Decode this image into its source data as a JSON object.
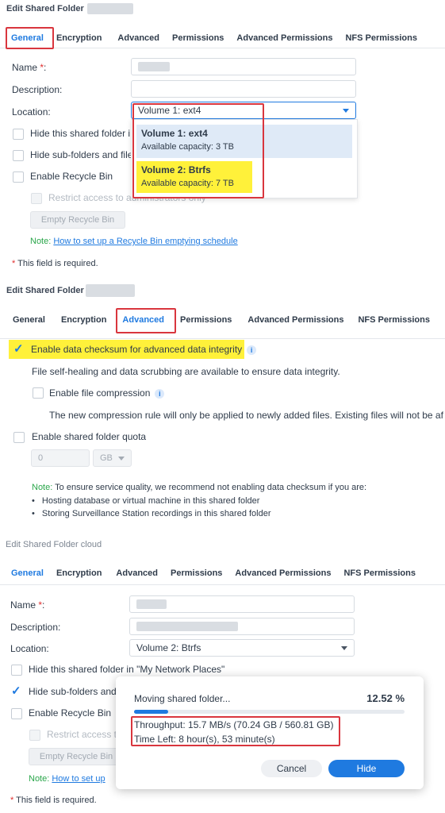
{
  "panel1": {
    "title": "Edit Shared Folder",
    "tabs": [
      "General",
      "Encryption",
      "Advanced",
      "Permissions",
      "Advanced Permissions",
      "NFS Permissions"
    ],
    "name_label": "Name",
    "description_label": "Description:",
    "location_label": "Location:",
    "location_value": "Volume 1:  ext4",
    "hide_folder_label": "Hide this shared folder i",
    "hide_subfolders_label": "Hide sub-folders and file",
    "recycle_label": "Enable Recycle Bin",
    "restrict_label": "Restrict access to administrators only",
    "empty_recycle_btn": "Empty Recycle Bin",
    "note_key": "Note:",
    "note_link": "How to set up a Recycle Bin emptying schedule",
    "required_text": "This field is required.",
    "dropdown": [
      {
        "title": "Volume 1: ext4",
        "capacity": "Available capacity: 3 TB"
      },
      {
        "title": "Volume 2: Btrfs",
        "capacity": "Available capacity: 7 TB"
      }
    ]
  },
  "panel2": {
    "title": "Edit Shared Folder",
    "tabs": [
      "General",
      "Encryption",
      "Advanced",
      "Permissions",
      "Advanced Permissions",
      "NFS Permissions"
    ],
    "checksum_label": "Enable data checksum for advanced data integrity",
    "checksum_desc": "File self-healing and data scrubbing are available to ensure data integrity.",
    "compression_label": "Enable file compression",
    "compression_desc": "The new compression rule will only be applied to newly added files. Existing files will not be af",
    "quota_label": "Enable shared folder quota",
    "quota_value": "0",
    "quota_unit": "GB",
    "note_key": "Note:",
    "note_text": "To ensure service quality, we recommend not enabling data checksum if you are:",
    "bullets": [
      "Hosting database or virtual machine in this shared folder",
      "Storing Surveillance Station recordings in this shared folder"
    ]
  },
  "panel3": {
    "title": "Edit Shared Folder cloud",
    "tabs": [
      "General",
      "Encryption",
      "Advanced",
      "Permissions",
      "Advanced Permissions",
      "NFS Permissions"
    ],
    "name_label": "Name",
    "description_label": "Description:",
    "location_label": "Location:",
    "location_value": "Volume 2:  Btrfs",
    "hide_folder_label": "Hide this shared folder in \"My Network Places\"",
    "hide_subfolders_label": "Hide sub-folders and",
    "recycle_label": "Enable Recycle Bin",
    "restrict_label": "Restrict access t",
    "empty_recycle_btn": "Empty Recycle Bin",
    "note_key": "Note:",
    "note_link": "How to set up",
    "required_text": "This field is required."
  },
  "progress_dialog": {
    "title": "Moving shared folder...",
    "percent_text": "12.52 %",
    "progress": 0.1252,
    "throughput": "Throughput: 15.7 MB/s (70.24 GB / 560.81 GB)",
    "time_left": "Time Left: 8 hour(s), 53 minute(s)",
    "cancel_label": "Cancel",
    "hide_label": "Hide"
  },
  "colors": {
    "accent": "#1f7ae0",
    "highlight": "#fff13a",
    "annotation_red": "#d9363e",
    "required_red": "#e02f2f",
    "note_green": "#2aa64a"
  }
}
